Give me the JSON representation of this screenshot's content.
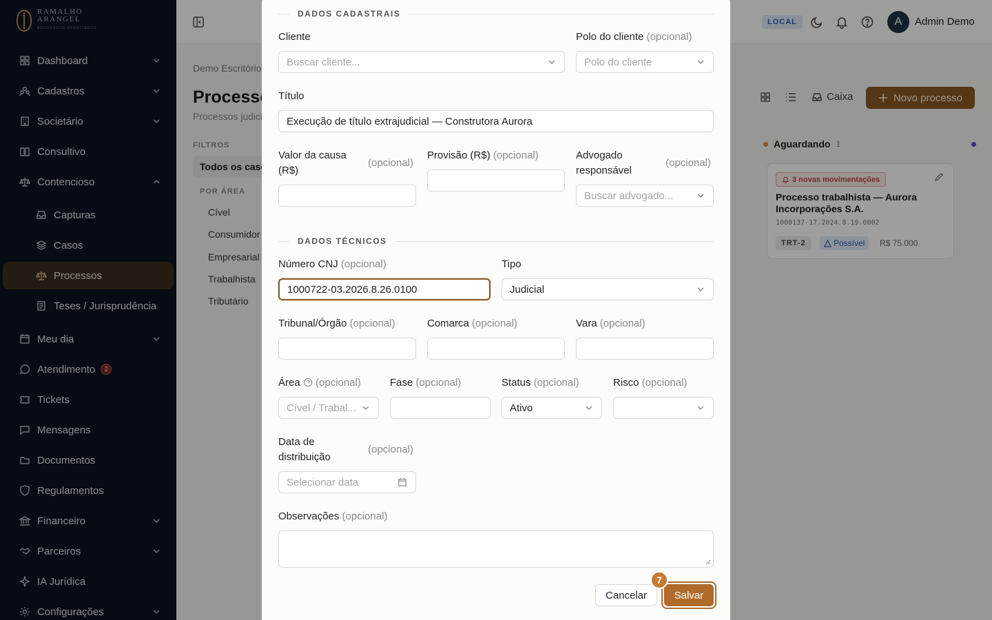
{
  "brand": {
    "line1": "RAMALHO",
    "line2": "ARANGEL",
    "tagline": "ADVOGADOS ASSOCIADOS"
  },
  "sidebar": {
    "items": [
      {
        "label": "Dashboard",
        "icon": "grid-icon",
        "expandable": true
      },
      {
        "label": "Cadastros",
        "icon": "users-icon",
        "expandable": true
      },
      {
        "label": "Societário",
        "icon": "building-icon",
        "expandable": true
      },
      {
        "label": "Consultivo",
        "icon": "book-icon",
        "expandable": false
      },
      {
        "label": "Contencioso",
        "icon": "scale-icon",
        "expandable": true,
        "expanded": true
      },
      {
        "label": "Capturas",
        "icon": "inbox-icon",
        "sub": true
      },
      {
        "label": "Casos",
        "icon": "layers-icon",
        "sub": true
      },
      {
        "label": "Processos",
        "icon": "scale-icon",
        "sub": true,
        "active": true
      },
      {
        "label": "Teses / Jurisprudência",
        "icon": "library-icon",
        "sub": true
      },
      {
        "label": "Meu dia",
        "icon": "calendar-icon",
        "expandable": true
      },
      {
        "label": "Atendimento",
        "icon": "chat-icon",
        "badge": "2"
      },
      {
        "label": "Tickets",
        "icon": "ticket-icon"
      },
      {
        "label": "Mensagens",
        "icon": "message-icon"
      },
      {
        "label": "Documentos",
        "icon": "folder-icon"
      },
      {
        "label": "Regulamentos",
        "icon": "shield-icon"
      },
      {
        "label": "Financeiro",
        "icon": "bank-icon",
        "expandable": true
      },
      {
        "label": "Parceiros",
        "icon": "handshake-icon",
        "expandable": true
      },
      {
        "label": "IA Jurídica",
        "icon": "sparkle-icon"
      },
      {
        "label": "Configurações",
        "icon": "gear-icon",
        "expandable": true
      }
    ]
  },
  "topbar": {
    "env": "LOCAL",
    "avatar_initial": "A",
    "username": "Admin Demo"
  },
  "page": {
    "breadcrumb": "Demo Escritório",
    "title": "Processos",
    "subtitle": "Processos judiciais",
    "filters_label": "FILTROS",
    "filter_all": "Todos os casos",
    "by_area_label": "POR ÁREA",
    "areas": [
      "Cível",
      "Consumidor",
      "Empresarial",
      "Trabalhista",
      "Tributário"
    ],
    "caixa": "Caixa",
    "new_button": "Novo processo"
  },
  "kanban": {
    "column": "Aguardando",
    "count": "1",
    "card": {
      "badge": "3 novas movimentações",
      "title": "Processo trabalhista — Aurora Incorporações S.A.",
      "number": "1000137-17.2024.8.19.0002",
      "tag": "TRT-2",
      "risk": "Possível",
      "value": "R$ 75.000"
    }
  },
  "modal": {
    "section1": "DADOS CADASTRAIS",
    "cliente_label": "Cliente",
    "cliente_placeholder": "Buscar cliente...",
    "polo_label": "Polo do cliente",
    "polo_placeholder": "Polo do cliente",
    "titulo_label": "Título",
    "titulo_value": "Execução de título extrajudicial — Construtora Aurora",
    "valor_label": "Valor da causa (R$)",
    "provisao_label": "Provisão (R$)",
    "advogado_label": "Advogado responsável",
    "advogado_placeholder": "Buscar advogado...",
    "section2": "DADOS TÉCNICOS",
    "cnj_label": "Número CNJ",
    "cnj_value": "1000722-03.2026.8.26.0100",
    "tipo_label": "Tipo",
    "tipo_value": "Judicial",
    "tribunal_label": "Tribunal/Órgão",
    "comarca_label": "Comarca",
    "vara_label": "Vara",
    "area_label": "Área",
    "area_placeholder": "Cível / Trabal...",
    "fase_label": "Fase",
    "status_label": "Status",
    "status_value": "Ativo",
    "risco_label": "Risco",
    "data_label": "Data de distribuição",
    "data_placeholder": "Selecionar data",
    "obs_label": "Observações",
    "optional": "(opcional)",
    "cancel": "Cancelar",
    "save": "Salvar",
    "step": "7"
  }
}
